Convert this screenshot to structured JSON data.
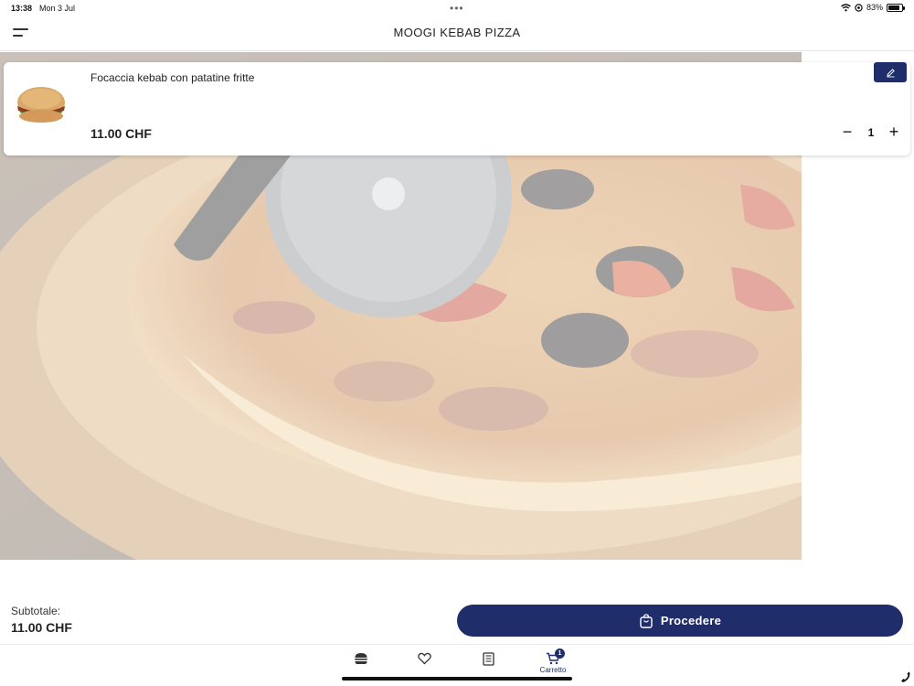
{
  "status_bar": {
    "time": "13:38",
    "date": "Mon 3 Jul",
    "battery": "83%",
    "battery_level": 0.83
  },
  "header": {
    "title": "MOOGI KEBAB PIZZA",
    "menu_icon": "hamburger-menu-icon"
  },
  "cart": {
    "items": [
      {
        "name": "Focaccia kebab con patatine fritte",
        "price": "11.00 CHF",
        "quantity": "1",
        "minus_symbol": "−",
        "plus_symbol": "+",
        "edit_icon": "pencil-icon"
      }
    ]
  },
  "summary": {
    "subtotal_label": "Subtotale:",
    "subtotal_value": "11.00 CHF"
  },
  "checkout": {
    "label": "Procedere",
    "icon": "shopping-bag-icon"
  },
  "bottom_nav": {
    "items": [
      {
        "icon": "burger-icon"
      },
      {
        "icon": "heart-icon"
      },
      {
        "icon": "menu-book-icon"
      },
      {
        "icon": "cart-icon",
        "label": "Carretto",
        "badge": "1"
      }
    ]
  },
  "colors": {
    "primary": "#1f2d6b",
    "background": "#ffffff",
    "text": "#222222"
  }
}
